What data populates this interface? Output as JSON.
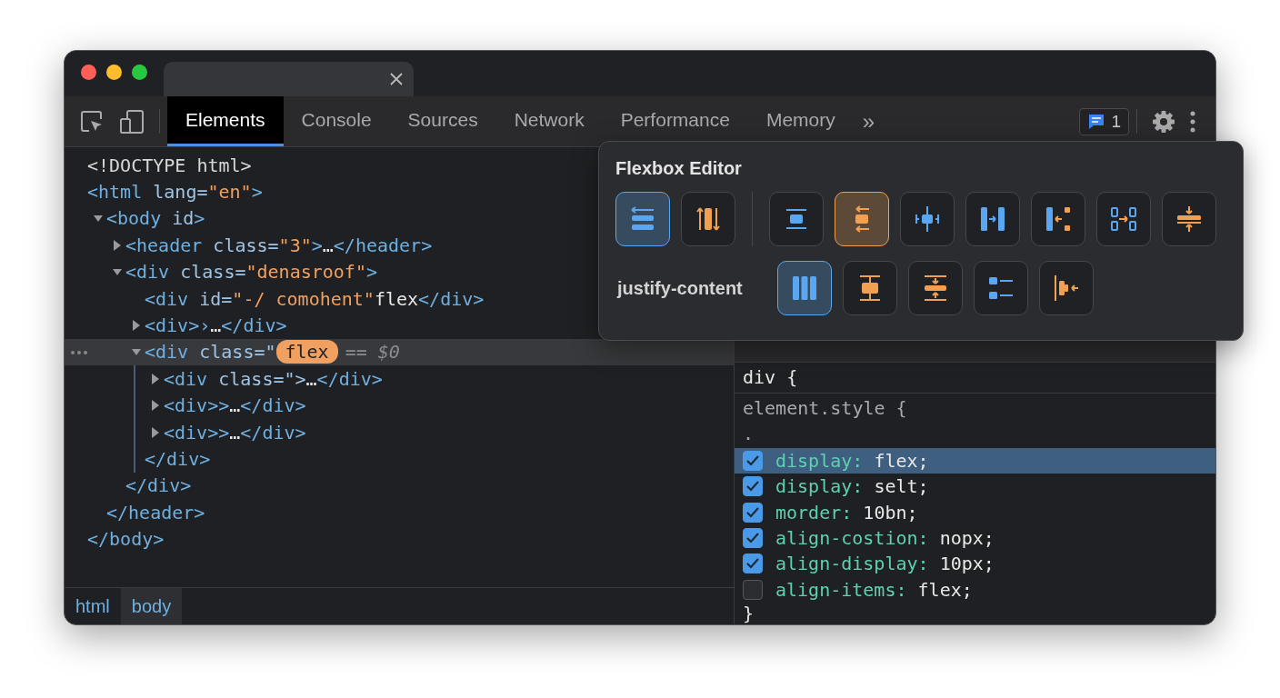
{
  "toolbar": {
    "tabs": [
      {
        "label": "Elements",
        "selected": true
      },
      {
        "label": "Console",
        "selected": false
      },
      {
        "label": "Sources",
        "selected": false
      },
      {
        "label": "Network",
        "selected": false
      },
      {
        "label": "Performance",
        "selected": false
      },
      {
        "label": "Memory",
        "selected": false
      }
    ],
    "more": "»",
    "issues": {
      "count": "1"
    }
  },
  "dom": [
    {
      "parts": [
        {
          "kind": "doctype",
          "text": "<!DOCTYPE html>"
        }
      ]
    },
    {
      "parts": [
        {
          "kind": "tag",
          "text": "<html"
        },
        {
          "kind": "attr",
          "text": " lang="
        },
        {
          "kind": "value",
          "text": "\"en\""
        },
        {
          "kind": "tag",
          "text": ">"
        }
      ],
      "closing": "</body>",
      "children": [
        {
          "expanded": true,
          "parts": [
            {
              "kind": "tag",
              "text": "<body"
            },
            {
              "kind": "attr",
              "text": " id"
            },
            {
              "kind": "tag",
              "text": ">"
            }
          ],
          "closing": "</header>",
          "children": [
            {
              "expanded": false,
              "parts": [
                {
                  "kind": "tag",
                  "text": "<header"
                },
                {
                  "kind": "attr",
                  "text": " class="
                },
                {
                  "kind": "value",
                  "text": "\"3\""
                },
                {
                  "kind": "tag",
                  "text": ">"
                },
                {
                  "kind": "text",
                  "text": "…"
                },
                {
                  "kind": "tag",
                  "text": "</header>"
                }
              ]
            },
            {
              "expanded": true,
              "parts": [
                {
                  "kind": "tag",
                  "text": "<div"
                },
                {
                  "kind": "attr",
                  "text": " class="
                },
                {
                  "kind": "value",
                  "text": "\"denasroof\""
                },
                {
                  "kind": "tag",
                  "text": ">"
                }
              ],
              "closing": "</div>",
              "children": [
                {
                  "parts": [
                    {
                      "kind": "tag",
                      "text": "<div"
                    },
                    {
                      "kind": "attr",
                      "text": " id="
                    },
                    {
                      "kind": "value",
                      "text": "\"-/ comohent\""
                    },
                    {
                      "kind": "text",
                      "text": "flex"
                    },
                    {
                      "kind": "tag",
                      "text": "</div>"
                    }
                  ]
                },
                {
                  "expanded": false,
                  "parts": [
                    {
                      "kind": "tag",
                      "text": "<div>"
                    },
                    {
                      "kind": "tag",
                      "text": "›"
                    },
                    {
                      "kind": "text",
                      "text": "…"
                    },
                    {
                      "kind": "tag",
                      "text": "</div>"
                    }
                  ]
                },
                {
                  "expanded": true,
                  "selected": true,
                  "parts": [
                    {
                      "kind": "tag",
                      "text": "<div"
                    },
                    {
                      "kind": "attr",
                      "text": " class=\""
                    },
                    {
                      "kind": "badge",
                      "text": "flex"
                    },
                    {
                      "kind": "ref",
                      "text": "== $0"
                    }
                  ],
                  "closing": "</div>",
                  "children": [
                    {
                      "expanded": false,
                      "parts": [
                        {
                          "kind": "tag",
                          "text": "<div"
                        },
                        {
                          "kind": "attr",
                          "text": " class=\">"
                        },
                        {
                          "kind": "text",
                          "text": "…"
                        },
                        {
                          "kind": "tag",
                          "text": "</div>"
                        }
                      ]
                    },
                    {
                      "expanded": false,
                      "parts": [
                        {
                          "kind": "tag",
                          "text": "<div>>"
                        },
                        {
                          "kind": "text",
                          "text": "…"
                        },
                        {
                          "kind": "tag",
                          "text": "</div>"
                        }
                      ]
                    },
                    {
                      "expanded": false,
                      "parts": [
                        {
                          "kind": "tag",
                          "text": "<div>>"
                        },
                        {
                          "kind": "text",
                          "text": "…"
                        },
                        {
                          "kind": "tag",
                          "text": "</div>"
                        }
                      ]
                    }
                  ]
                }
              ]
            }
          ]
        }
      ]
    }
  ],
  "breadcrumbs": [
    {
      "label": "html",
      "selected": false
    },
    {
      "label": "body",
      "selected": true
    }
  ],
  "styles": {
    "selector": "div {",
    "rule": "element.style {",
    "dot": ".",
    "declarations": [
      {
        "property": "display:",
        "value": "flex;",
        "checked": true,
        "selected": true
      },
      {
        "property": "display:",
        "value": "selt;",
        "checked": true,
        "selected": false
      },
      {
        "property": "morder:",
        "value": "10bn;",
        "checked": true,
        "selected": false
      },
      {
        "property": "align-costion:",
        "value": "nopx;",
        "checked": true,
        "selected": false
      },
      {
        "property": "align-display:",
        "value": "10px;",
        "checked": true,
        "selected": false
      },
      {
        "property": "align-items:",
        "value": "flex;",
        "checked": false,
        "selected": false
      }
    ],
    "close": "}"
  },
  "flexbox_editor": {
    "title": "Flexbox Editor",
    "direction": [
      {
        "kind": "rows",
        "color": "#5aa6f0",
        "selected": true
      },
      {
        "kind": "columns",
        "color": "#f0a050",
        "selected": false
      }
    ],
    "alignment": [
      {
        "kind": "center-box",
        "color": "#5aa6f0",
        "selected": false
      },
      {
        "kind": "center-arrows",
        "color": "#f0a050",
        "selected": true
      },
      {
        "kind": "center-ticks",
        "color": "#5aa6f0",
        "selected": false
      },
      {
        "kind": "move-right",
        "color": "#5aa6f0",
        "selected": false
      },
      {
        "kind": "pull-left",
        "color": "#5aa6f0",
        "selected": false
      },
      {
        "kind": "spread",
        "color": "#5aa6f0",
        "selected": false
      },
      {
        "kind": "squeeze",
        "color": "#f0a050",
        "selected": false
      }
    ],
    "justify": {
      "label": "justify-content",
      "options": [
        {
          "kind": "three-bars",
          "color": "#5aa6f0",
          "selected": true
        },
        {
          "kind": "column-center",
          "color": "#f0a050",
          "selected": false
        },
        {
          "kind": "column-stretch",
          "color": "#f0a050",
          "selected": false
        },
        {
          "kind": "list",
          "color": "#5aa6f0",
          "selected": false
        },
        {
          "kind": "pull-bar",
          "color": "#f0a050",
          "selected": false
        }
      ]
    }
  }
}
